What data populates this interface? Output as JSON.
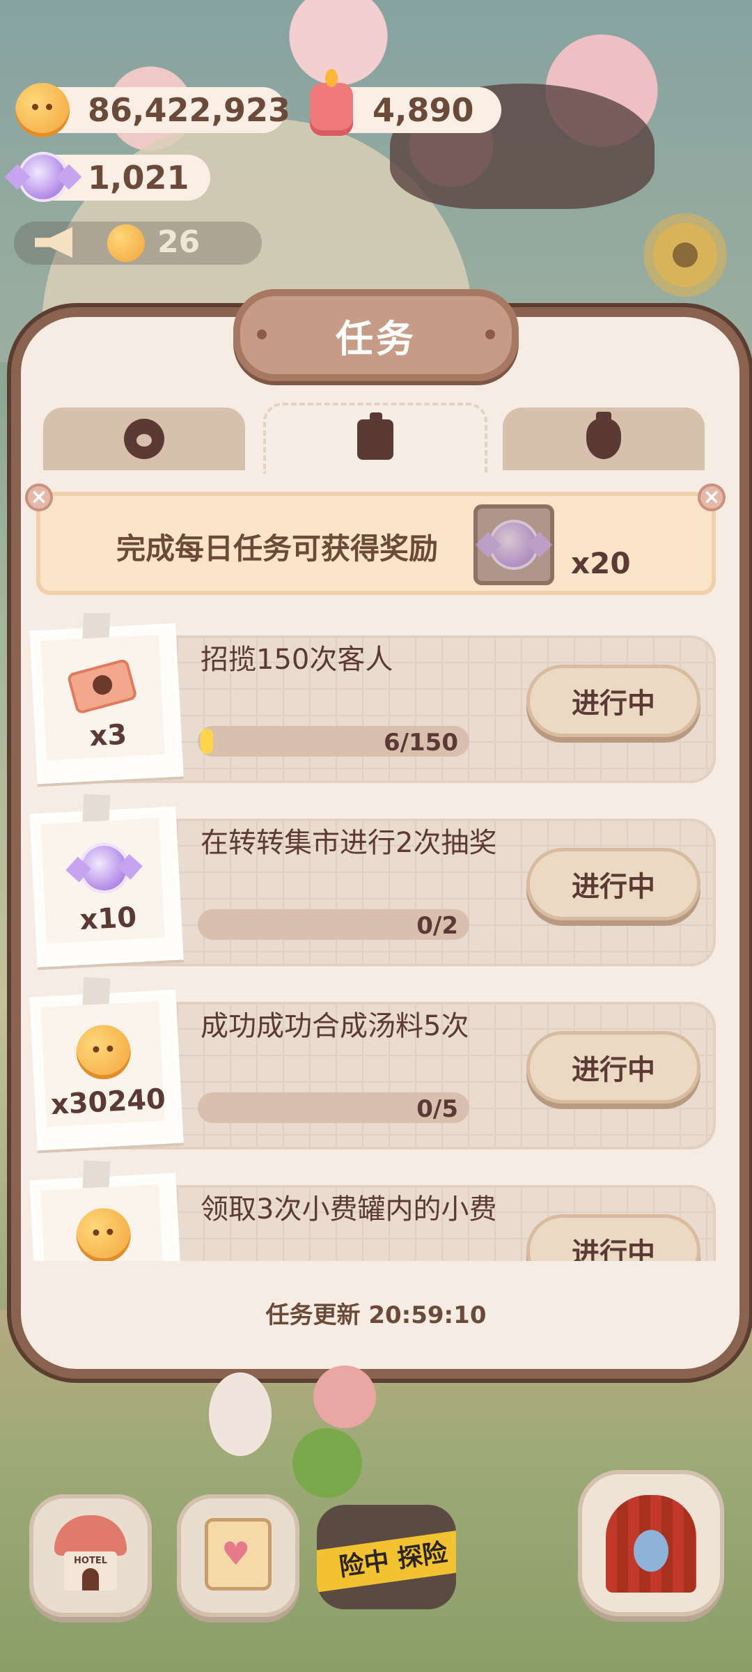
{
  "currencies": {
    "coins": "86,422,923",
    "candles": "4,890",
    "candies": "1,021"
  },
  "notice": {
    "count": "26"
  },
  "modal": {
    "title": "任务",
    "tabs": [
      {
        "icon": "paw-badge-icon",
        "active": false
      },
      {
        "icon": "pen-note-icon",
        "active": true
      },
      {
        "icon": "bottle-heart-icon",
        "active": false
      }
    ],
    "daily_banner": {
      "text": "完成每日任务可获得奖励",
      "reward_icon": "candy-icon",
      "reward_qty": "x20"
    },
    "tasks": [
      {
        "reward_icon": "ticket-icon",
        "reward_qty": "x3",
        "title": "招揽150次客人",
        "progress_text": "6/150",
        "progress": 0.04,
        "status": "进行中"
      },
      {
        "reward_icon": "candy-icon",
        "reward_qty": "x10",
        "title": "在转转集市进行2次抽奖",
        "progress_text": "0/2",
        "progress": 0,
        "status": "进行中"
      },
      {
        "reward_icon": "coin-icon",
        "reward_qty": "x30240",
        "title": "成功成功合成汤料5次",
        "progress_text": "0/5",
        "progress": 0,
        "status": "进行中"
      },
      {
        "reward_icon": "coin-icon",
        "reward_qty": "",
        "title": "领取3次小费罐内的小费",
        "progress_text": "",
        "progress": 0,
        "status": "进行中"
      }
    ],
    "refresh_timer": "任务更新 20:59:10"
  },
  "bottom_nav": {
    "hotel_sign": "HOTEL",
    "adventure_tape": "险中 探险"
  },
  "colors": {
    "panel": "#f7ece3",
    "accent_brown": "#5b3a35",
    "progress_fill": "#ffd54a"
  }
}
